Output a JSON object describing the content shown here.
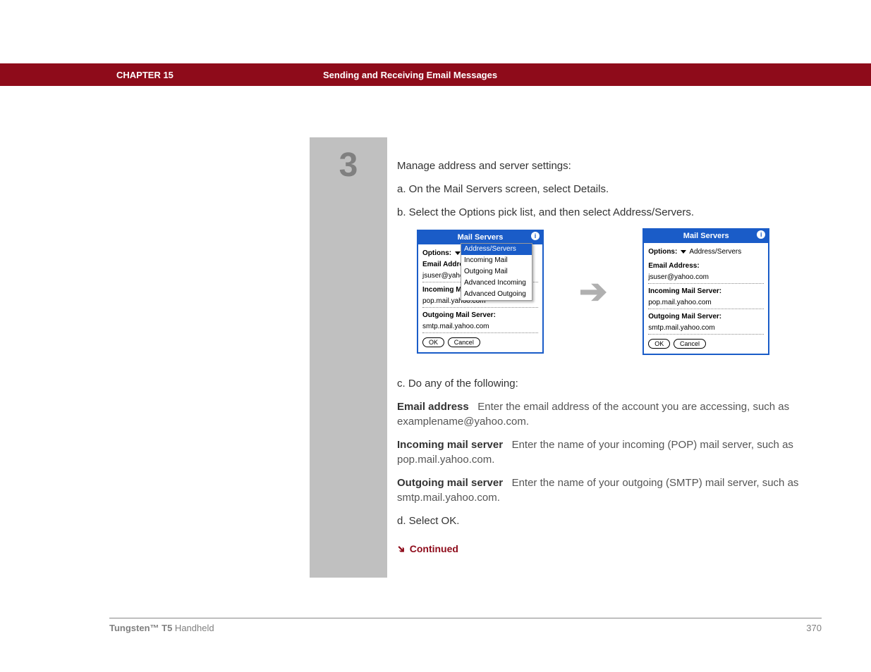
{
  "header": {
    "chapter": "CHAPTER 15",
    "title": "Sending and Receiving Email Messages"
  },
  "step": {
    "number": "3",
    "intro": "Manage address and server settings:",
    "a": "a.  On the Mail Servers screen, select Details.",
    "b": "b.  Select the Options pick list, and then select Address/Servers.",
    "c": "c.  Do any of the following:",
    "d": "d.  Select OK.",
    "continued": "Continued"
  },
  "defs": {
    "email_label": "Email address",
    "email_text": "Enter the email address of the account you are accessing, such as examplename@yahoo.com.",
    "incoming_label": "Incoming mail server",
    "incoming_text": "Enter the name of your incoming (POP) mail server, such as pop.mail.yahoo.com.",
    "outgoing_label": "Outgoing mail server",
    "outgoing_text": "Enter the name of your outgoing (SMTP) mail server, such as smtp.mail.yahoo.com."
  },
  "palm": {
    "title": "Mail Servers",
    "options_label": "Options:",
    "selected_option": "Address/Servers",
    "menu": {
      "i0": "Address/Servers",
      "i1": "Incoming Mail",
      "i2": "Outgoing Mail",
      "i3": "Advanced Incoming",
      "i4": "Advanced Outgoing"
    },
    "left": {
      "email_label": "Email Addre",
      "email_value": "jsuser@yaho",
      "incoming_label": "Incoming Mail Server:",
      "incoming_value": "pop.mail.yahoo.com",
      "outgoing_label": "Outgoing Mail Server:",
      "outgoing_value": "smtp.mail.yahoo.com"
    },
    "right": {
      "email_label": "Email Address:",
      "email_value": "jsuser@yahoo.com",
      "incoming_label": "Incoming Mail Server:",
      "incoming_value": "pop.mail.yahoo.com",
      "outgoing_label": "Outgoing Mail Server:",
      "outgoing_value": "smtp.mail.yahoo.com"
    },
    "ok": "OK",
    "cancel": "Cancel"
  },
  "footer": {
    "product_bold": "Tungsten™ T5",
    "product_rest": " Handheld",
    "page": "370"
  }
}
